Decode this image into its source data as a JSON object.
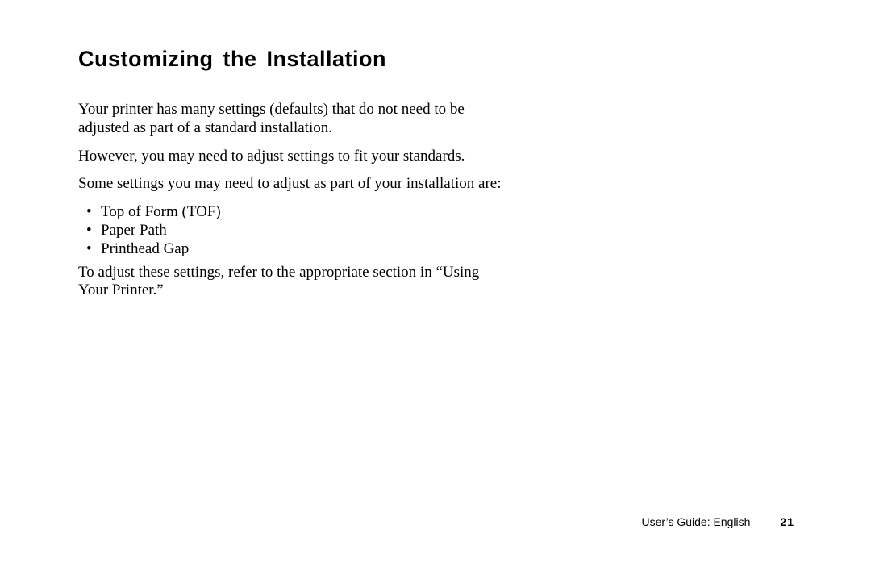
{
  "heading": "Customizing the Installation",
  "paragraphs": {
    "p1": "Your printer has many settings (defaults) that do not need to be adjusted as part of a standard installation.",
    "p2": "However, you may need to adjust settings to fit your standards.",
    "p3": "Some settings you may need to adjust as part of your installation are:",
    "p4": "To adjust these settings, refer to the appropriate section in “Using Your Printer.”"
  },
  "list": {
    "i1": "Top of Form (TOF)",
    "i2": "Paper Path",
    "i3": "Printhead Gap"
  },
  "footer": {
    "label": "User’s Guide: English",
    "page": "21"
  }
}
